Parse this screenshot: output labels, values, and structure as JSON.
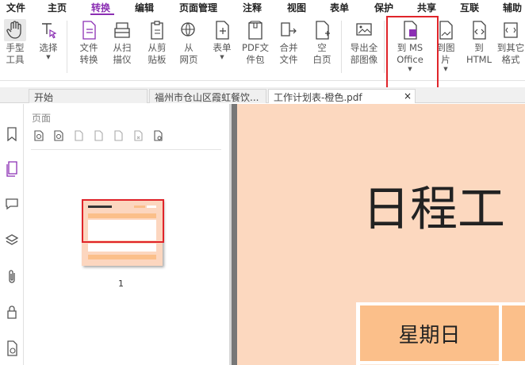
{
  "menu": [
    "文件",
    "主页",
    "转换",
    "编辑",
    "页面管理",
    "注释",
    "视图",
    "表单",
    "保护",
    "共享",
    "互联",
    "辅助"
  ],
  "ribbon": {
    "hand": [
      "手型",
      "工具"
    ],
    "select": [
      "选择"
    ],
    "file_convert": [
      "文件",
      "转换"
    ],
    "scan": [
      "从扫",
      "描仪"
    ],
    "clipboard": [
      "从剪",
      "贴板"
    ],
    "web": [
      "从",
      "网页"
    ],
    "form": [
      "表单"
    ],
    "pdf_pack": [
      "PDF文",
      "件包"
    ],
    "merge": [
      "合并",
      "文件"
    ],
    "blank": [
      "空",
      "白页"
    ],
    "export_images": [
      "导出全",
      "部图像"
    ],
    "to_office": [
      "到 MS",
      "Office"
    ],
    "to_image": [
      "到图",
      "片"
    ],
    "to_html": [
      "到",
      "HTML"
    ],
    "to_other": [
      "到其它",
      "格式"
    ]
  },
  "tabs": [
    {
      "label": "开始"
    },
    {
      "label": "福州市仓山区霞虹餐饮..."
    },
    {
      "label": "工作计划表-橙色.pdf",
      "close": "×"
    }
  ],
  "panel": {
    "title": "页面",
    "page_number": "1"
  },
  "document": {
    "heading": "日程工",
    "cell_label": "星期日"
  },
  "colors": {
    "accent": "#8b2fb3",
    "highlight": "#e0242a",
    "page_bg": "#fcd8bf",
    "cell_bg": "#fbbf8a"
  }
}
